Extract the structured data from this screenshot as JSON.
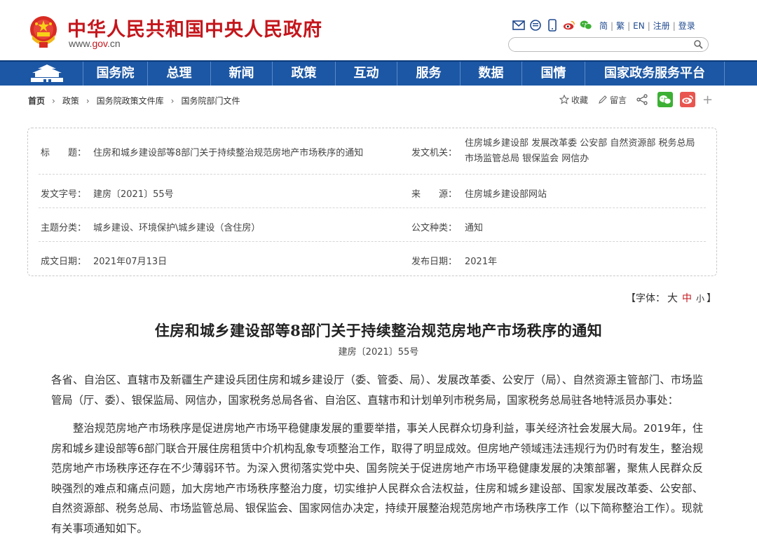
{
  "header": {
    "site_title": "中华人民共和国中央人民政府",
    "site_url_prefix": "www.",
    "site_url_domain": "gov",
    "site_url_suffix": ".cn",
    "top_icons": [
      "mail-icon",
      "message-icon",
      "mobile-icon",
      "weibo-icon",
      "wechat-icon"
    ],
    "links": [
      "简",
      "繁",
      "EN",
      "注册",
      "登录"
    ],
    "search_placeholder": ""
  },
  "nav": {
    "items": [
      "国务院",
      "总理",
      "新闻",
      "政策",
      "互动",
      "服务",
      "数据",
      "国情",
      "国家政务服务平台"
    ]
  },
  "breadcrumb": {
    "items": [
      "首页",
      "政策",
      "国务院政策文件库",
      "国务院部门文件"
    ]
  },
  "share": {
    "favorite": "收藏",
    "comment": "留言"
  },
  "meta": {
    "title_label": "标　　题：",
    "title_value": "住房和城乡建设部等8部门关于持续整治规范房地产市场秩序的通知",
    "issuer_label": "发文机关：",
    "issuer_value": "住房城乡建设部 发展改革委 公安部 自然资源部 税务总局 市场监管总局 银保监会 网信办",
    "doc_no_label": "发文字号：",
    "doc_no_value": "建房〔2021〕55号",
    "source_label": "来　　源：",
    "source_value": "住房城乡建设部网站",
    "topic_label": "主题分类：",
    "topic_value": "城乡建设、环境保护\\城乡建设（含住房）",
    "type_label": "公文种类：",
    "type_value": "通知",
    "date_label": "成文日期：",
    "date_value": "2021年07月13日",
    "pub_label": "发布日期：",
    "pub_value": "2021年"
  },
  "fontsize": {
    "prefix": "【字体：",
    "large": "大",
    "medium": "中",
    "small": "小",
    "suffix": "】"
  },
  "article": {
    "title": "住房和城乡建设部等8部门关于持续整治规范房地产市场秩序的通知",
    "doc_number": "建房〔2021〕55号",
    "paragraphs": [
      "各省、自治区、直辖市及新疆生产建设兵团住房和城乡建设厅（委、管委、局）、发展改革委、公安厅（局）、自然资源主管部门、市场监管局（厅、委）、银保监局、网信办，国家税务总局各省、自治区、直辖市和计划单列市税务局，国家税务总局驻各地特派员办事处：",
      "整治规范房地产市场秩序是促进房地产市场平稳健康发展的重要举措，事关人民群众切身利益，事关经济社会发展大局。2019年，住房和城乡建设部等6部门联合开展住房租赁中介机构乱象专项整治工作，取得了明显成效。但房地产领域违法违规行为仍时有发生，整治规范房地产市场秩序还存在不少薄弱环节。为深入贯彻落实党中央、国务院关于促进房地产市场平稳健康发展的决策部署，聚焦人民群众反映强烈的难点和痛点问题，加大房地产市场秩序整治力度，切实维护人民群众合法权益，住房和城乡建设部、国家发展改革委、公安部、自然资源部、税务总局、市场监管总局、银保监会、国家网信办决定，持续开展整治规范房地产市场秩序工作（以下简称整治工作）。现就有关事项通知如下。"
    ]
  },
  "colors": {
    "brand_red": "#c4161c",
    "nav_blue": "#1c57a5"
  }
}
